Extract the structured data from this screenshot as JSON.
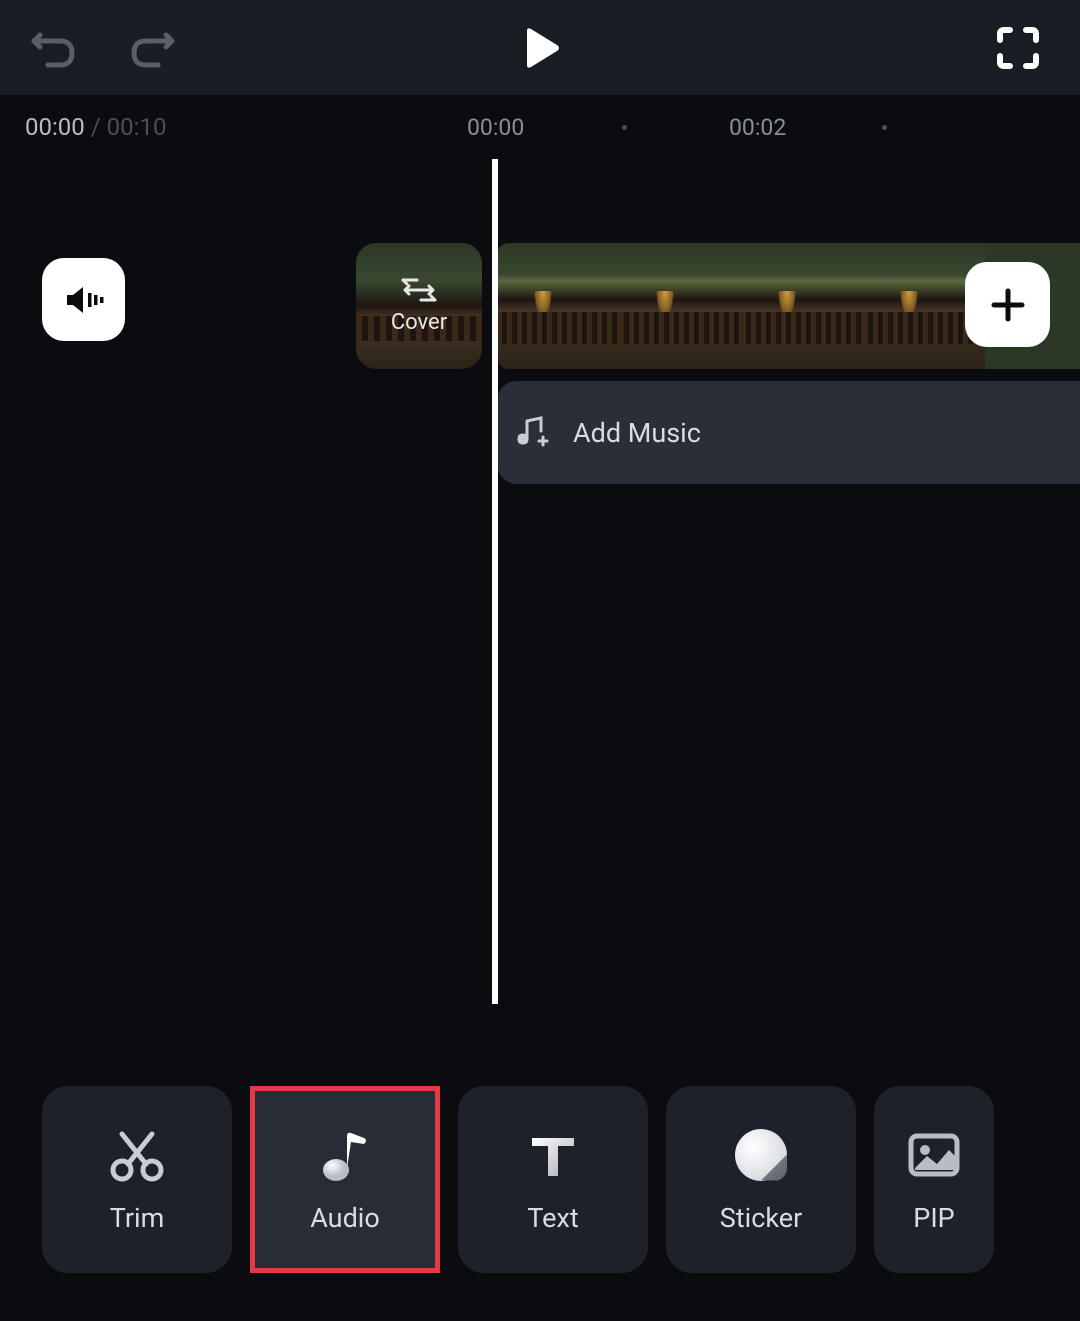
{
  "toolbar": {
    "time": {
      "current": "00:00",
      "separator": "/",
      "total": "00:10"
    }
  },
  "timeline": {
    "markers": {
      "m0": "00:00",
      "m1": "00:02"
    },
    "cover_label": "Cover",
    "add_music_label": "Add Music"
  },
  "tools": {
    "trim": "Trim",
    "audio": "Audio",
    "text": "Text",
    "sticker": "Sticker",
    "pip": "PIP"
  }
}
